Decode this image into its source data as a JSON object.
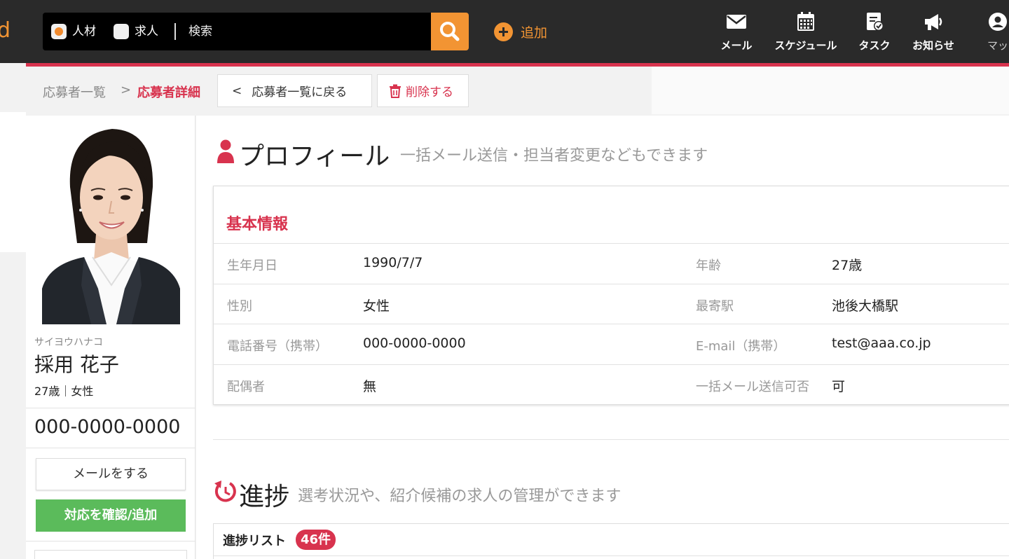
{
  "header": {
    "logo_fragment": "d",
    "search": {
      "radio_talent": "人材",
      "radio_jobs": "求人",
      "placeholder": "検索"
    },
    "add_label": "追加",
    "nav": [
      {
        "label": "メール",
        "icon": "mail-icon"
      },
      {
        "label": "スケジュール",
        "icon": "calendar-icon"
      },
      {
        "label": "タスク",
        "icon": "task-icon"
      },
      {
        "label": "お知らせ",
        "icon": "megaphone-icon"
      },
      {
        "label": "マッ",
        "icon": "user-icon"
      }
    ],
    "accent_color": "#d8334e",
    "brand_color": "#f29433"
  },
  "breadcrumb": {
    "parent": "応募者一覧",
    "separator": ">",
    "current": "応募者詳細",
    "back_button": "応募者一覧に戻る",
    "back_chevron": "<",
    "delete_button": "削除する"
  },
  "profile_card": {
    "kana": "サイヨウハナコ",
    "name": "採用 花子",
    "age_sex": "27歳｜女性",
    "phone": "000-0000-0000",
    "mail_button": "メールをする",
    "confirm_button": "対応を確認/追加"
  },
  "profile_section": {
    "title": "プロフィール",
    "subtitle": "一括メール送信・担当者変更などもできます",
    "basic_info": {
      "heading": "基本情報",
      "rows": [
        {
          "label_left": "生年月日",
          "value_left": "1990/7/7",
          "label_right": "年齢",
          "value_right": "27歳"
        },
        {
          "label_left": "性別",
          "value_left": "女性",
          "label_right": "最寄駅",
          "value_right": "池後大橋駅"
        },
        {
          "label_left": "電話番号（携帯）",
          "value_left": "000-0000-0000",
          "label_right": "E-mail（携帯）",
          "value_right": "test@aaa.co.jp"
        },
        {
          "label_left": "配偶者",
          "value_left": "無",
          "label_right": "一括メール送信可否",
          "value_right": "可"
        }
      ]
    }
  },
  "progress_section": {
    "title": "進捗",
    "subtitle": "選考状況や、紹介候補の求人の管理ができます",
    "list_title": "進捗リスト",
    "list_count": "46件"
  }
}
